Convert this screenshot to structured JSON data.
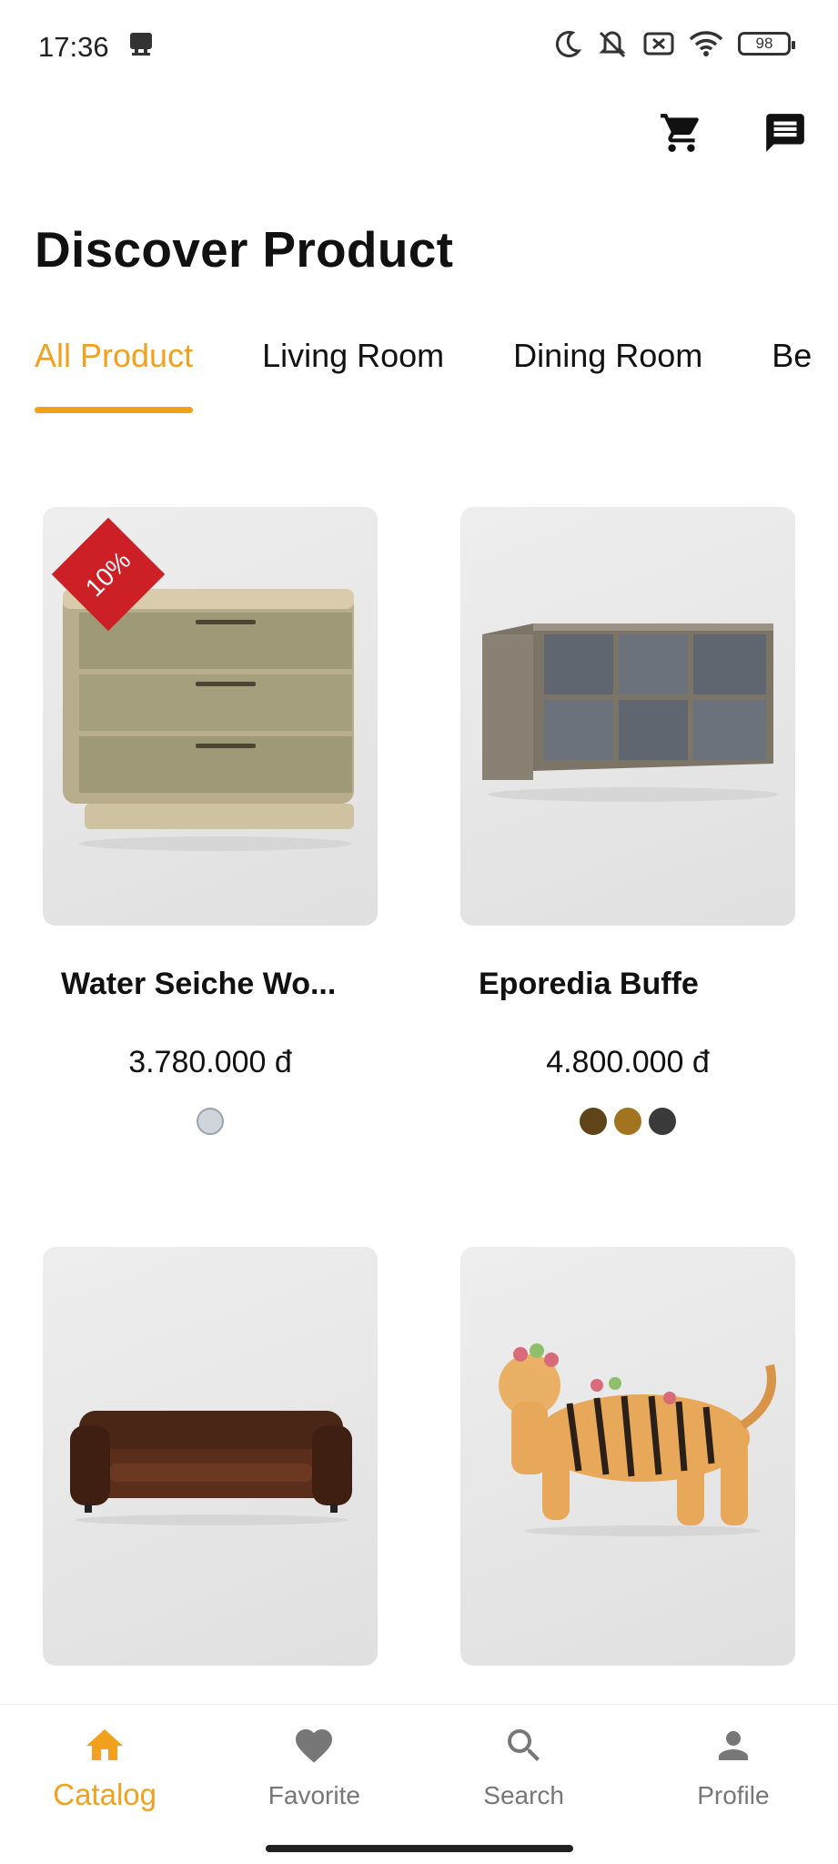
{
  "status_bar": {
    "time": "17:36",
    "battery": "98",
    "icons": [
      "notification-icon",
      "moon-icon",
      "mute-icon",
      "no-sim-icon",
      "wifi-icon",
      "battery-icon"
    ]
  },
  "header": {
    "cart_icon": "cart-icon",
    "chat_icon": "chat-icon"
  },
  "page": {
    "title": "Discover Product"
  },
  "tabs": [
    {
      "label": "All Product",
      "active": true
    },
    {
      "label": "Living Room",
      "active": false
    },
    {
      "label": "Dining Room",
      "active": false
    },
    {
      "label": "Be",
      "active": false
    }
  ],
  "products": [
    {
      "name": "Water Seiche Wo...",
      "price": "3.780.000 đ",
      "badge": "10%",
      "image": "nightstand",
      "colors": [
        "#cfd5da"
      ]
    },
    {
      "name": "Eporedia Buffe",
      "price": "4.800.000 đ",
      "badge": "",
      "image": "buffet",
      "colors": [
        "#5e4418",
        "#a3741f",
        "#3a3a3a"
      ]
    },
    {
      "name": "",
      "price": "",
      "badge": "",
      "image": "leather-sofa",
      "colors": []
    },
    {
      "name": "",
      "price": "",
      "badge": "",
      "image": "tiger-figurine",
      "colors": []
    }
  ],
  "bottom_nav": [
    {
      "label": "Catalog",
      "icon": "home-icon",
      "active": true
    },
    {
      "label": "Favorite",
      "icon": "heart-icon",
      "active": false
    },
    {
      "label": "Search",
      "icon": "search-icon",
      "active": false
    },
    {
      "label": "Profile",
      "icon": "person-icon",
      "active": false
    }
  ],
  "colors": {
    "accent": "#F2A11F",
    "badge": "#cc1f26",
    "inactive": "#777777"
  }
}
